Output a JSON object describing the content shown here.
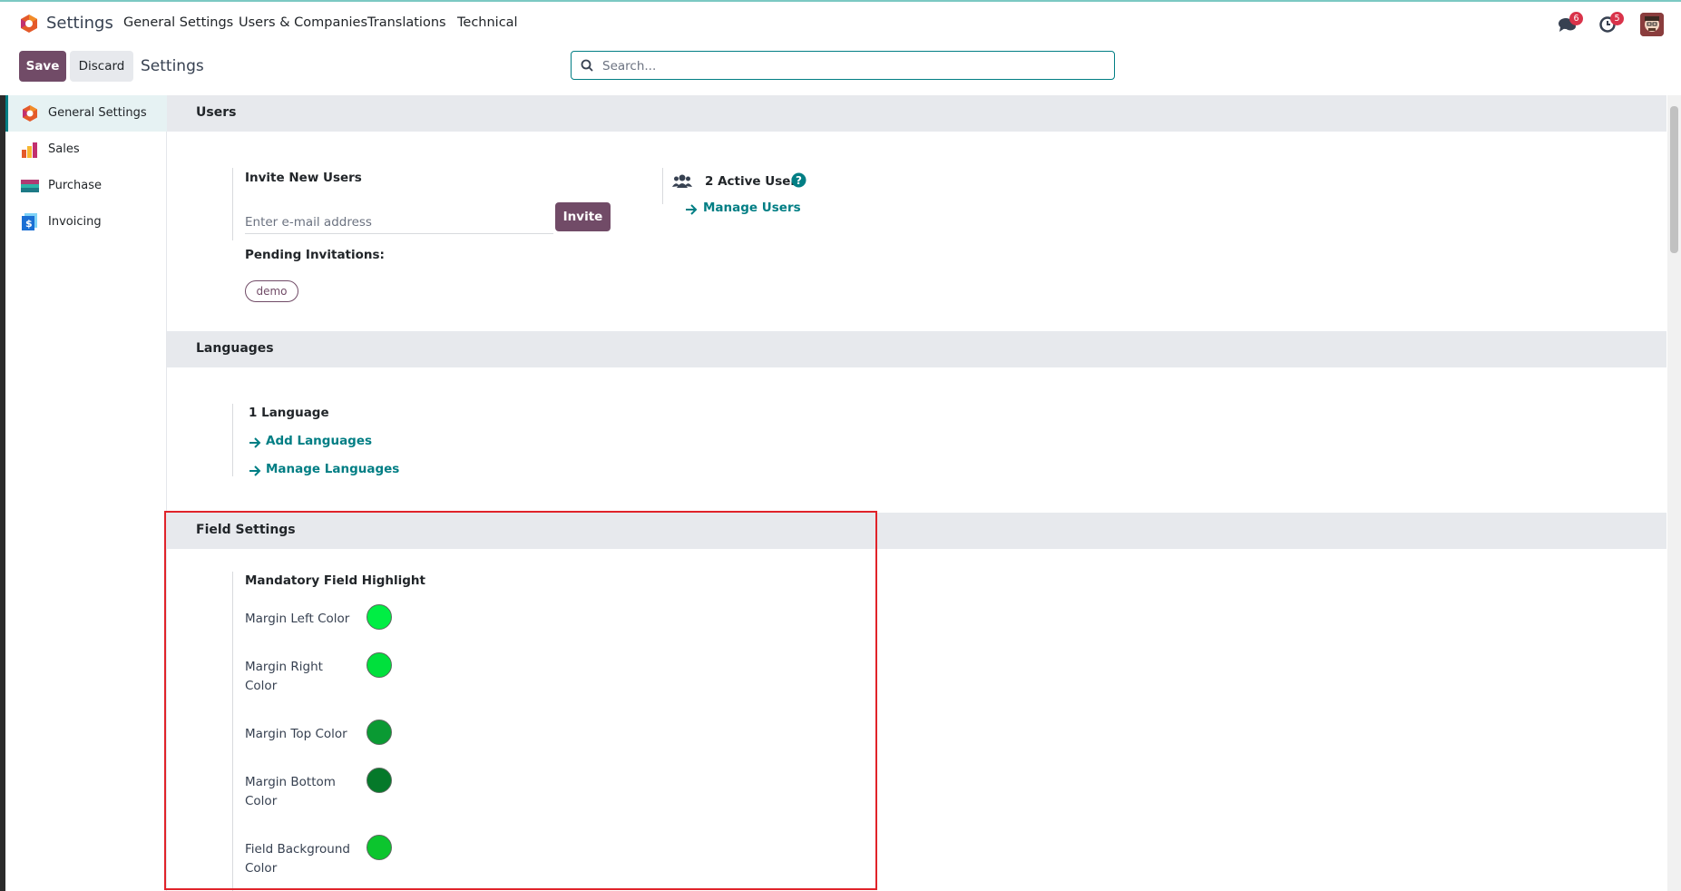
{
  "navbar": {
    "app_title": "Settings",
    "menu": [
      "General Settings",
      "Users & Companies",
      "Translations",
      "Technical"
    ],
    "messages_badge": "6",
    "activity_badge": "5"
  },
  "control_panel": {
    "save_label": "Save",
    "discard_label": "Discard",
    "breadcrumb": "Settings",
    "search_placeholder": "Search..."
  },
  "sidebar": {
    "items": [
      {
        "label": "General Settings",
        "icon": "settings-app-icon",
        "active": true
      },
      {
        "label": "Sales",
        "icon": "sales-app-icon",
        "active": false
      },
      {
        "label": "Purchase",
        "icon": "purchase-app-icon",
        "active": false
      },
      {
        "label": "Invoicing",
        "icon": "invoicing-app-icon",
        "active": false
      }
    ]
  },
  "users_section": {
    "title": "Users",
    "invite_title": "Invite New Users",
    "email_placeholder": "Enter e-mail address",
    "invite_button": "Invite",
    "pending_label": "Pending Invitations:",
    "pending_tags": [
      "demo"
    ],
    "active_users": "2 Active User",
    "manage_users": "Manage Users"
  },
  "languages_section": {
    "title": "Languages",
    "count": "1 Language",
    "add_link": "Add Languages",
    "manage_link": "Manage Languages"
  },
  "field_settings_section": {
    "title": "Field Settings",
    "subtitle": "Mandatory Field Highlight",
    "colors": [
      {
        "label_lines": [
          "Margin Left Color"
        ],
        "color": "#00ee44"
      },
      {
        "label_lines": [
          "Margin Right",
          "Color"
        ],
        "color": "#00e03c"
      },
      {
        "label_lines": [
          "Margin Top Color"
        ],
        "color": "#0a9a33"
      },
      {
        "label_lines": [
          "Margin Bottom",
          "Color"
        ],
        "color": "#05792a"
      },
      {
        "label_lines": [
          "Field Background",
          "Color"
        ],
        "color": "#0cc52e"
      }
    ]
  },
  "colors": {
    "brand": "#714b67",
    "link": "#017e84",
    "badge": "#d9334a",
    "highlight_border": "#e0232a",
    "section_header_bg": "#e7e9ed"
  }
}
